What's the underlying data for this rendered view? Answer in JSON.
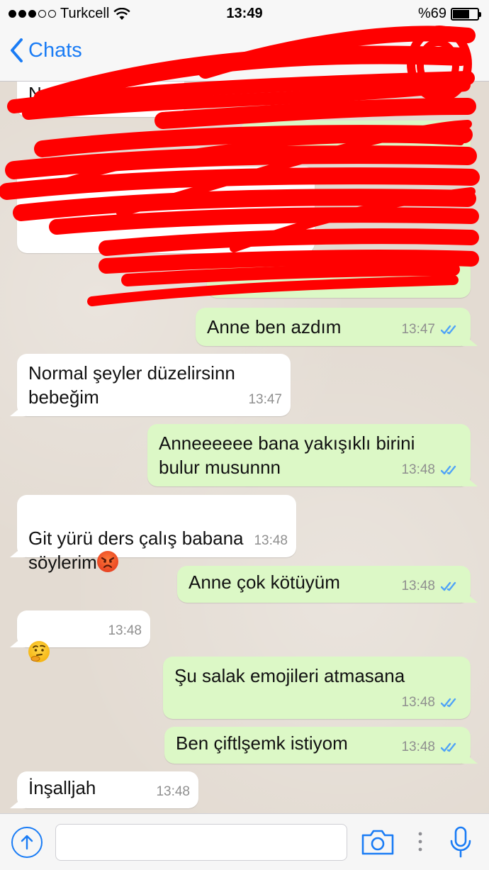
{
  "status_bar": {
    "carrier": "Turkcell",
    "time": "13:49",
    "battery": "%69",
    "battery_level": 0.69
  },
  "nav": {
    "back_label": "Chats"
  },
  "colors": {
    "accent": "#1a7cf5",
    "incoming_bubble": "#ffffff",
    "outgoing_bubble": "#dcf8c6",
    "read_ticks": "#4fa3f7",
    "scribble": "#ff0000"
  },
  "censored_messages": {
    "visible_fragment": "Nokia"
  },
  "messages": [
    {
      "direction": "out",
      "text": "Anne ben azdım",
      "time": "13:47",
      "status": "read"
    },
    {
      "direction": "in",
      "text": "Normal şeyler düzelirsinn\nbebeğim",
      "time": "13:47"
    },
    {
      "direction": "out",
      "text": "Anneeeeee bana yakışıklı birini\nbulur musunnn",
      "time": "13:48",
      "status": "read"
    },
    {
      "direction": "in",
      "text": "Git yürü ders çalış babana\nsöylerim",
      "emoji": "angry-face",
      "time": "13:48"
    },
    {
      "direction": "out",
      "text": "Anne çok kötüyüm",
      "time": "13:48",
      "status": "read"
    },
    {
      "direction": "in",
      "text": "",
      "emoji": "thinking-face",
      "time": "13:48"
    },
    {
      "direction": "out",
      "text": "Şu salak emojileri atmasana",
      "time": "13:48",
      "status": "read"
    },
    {
      "direction": "out",
      "text": "Ben çiftlşemk istiyom",
      "time": "13:48",
      "status": "read"
    },
    {
      "direction": "in",
      "text": "İnşalljah",
      "time": "13:48"
    }
  ],
  "input": {
    "placeholder": ""
  }
}
